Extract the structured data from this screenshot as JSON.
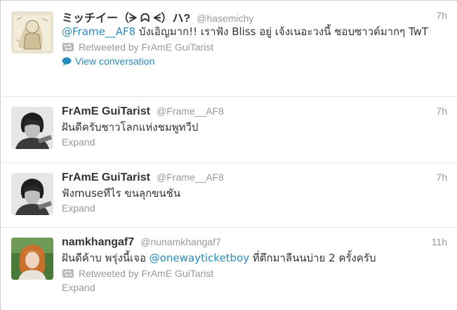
{
  "tweets": [
    {
      "name": "ミッチイー（ᗒ ᗣ ᗕ）ハ?",
      "handle": "@hasemichy",
      "time": "7h",
      "mention": "@Frame__AF8",
      "text": " บังเอิญมาก!! เราฟัง Bliss อยู่ เจ้งเนอะวงนี้ ชอบซาวด์มากๆ TwT",
      "retweeted_by": "Retweeted by FrAmE GuiTarist",
      "conversation": "View conversation"
    },
    {
      "name": "FrAmE GuiTarist",
      "handle": "@Frame__AF8",
      "time": "7h",
      "text": "ฝันดีครับชาวโลกแห่งชมพูทวีป",
      "expand": "Expand"
    },
    {
      "name": "FrAmE GuiTarist",
      "handle": "@Frame__AF8",
      "time": "7h",
      "text": "ฟังmuseทีไร ขนลุกขนชัน",
      "expand": "Expand"
    },
    {
      "name": "namkhangaf7",
      "handle": "@nunamkhangaf7",
      "time": "11h",
      "text_before": "ฝันดีค้าบ พรุ่งนี้เจอ ",
      "mention": "@onewayticketboy",
      "text_after": " ที่ตึกมาลีนนบ่าย 2 ครั้งครับ",
      "retweeted_by": "Retweeted by FrAmE GuiTarist",
      "expand": "Expand"
    }
  ],
  "colors": {
    "link": "#2a8bbd",
    "muted": "#999999",
    "text": "#333333"
  },
  "icons": {
    "retweet": "retweet-icon",
    "conversation": "speech-bubble-icon"
  }
}
